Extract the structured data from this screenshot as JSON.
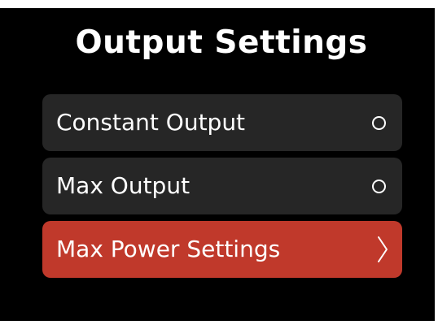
{
  "header": {
    "title": "Output Settings"
  },
  "menu": {
    "items": [
      {
        "label": "Constant Output",
        "control": "radio-icon",
        "selected": false
      },
      {
        "label": "Max Output",
        "control": "radio-icon",
        "selected": false
      },
      {
        "label": "Max Power Settings",
        "control": "chevron-right-icon",
        "selected": true
      }
    ]
  },
  "colors": {
    "background": "#000000",
    "item_background": "#262626",
    "selected_background": "#c0392b",
    "text": "#ffffff"
  }
}
